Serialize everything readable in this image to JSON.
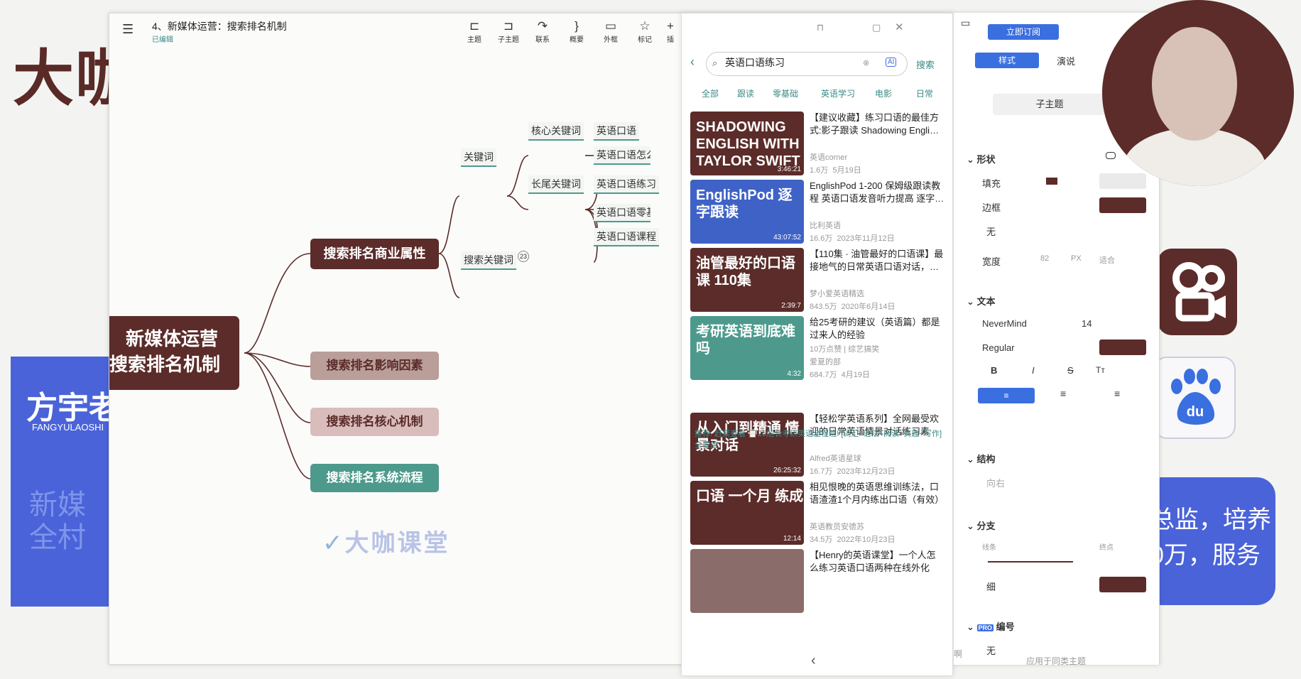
{
  "background": {
    "big_title": "大咖",
    "blue_card": {
      "name": "方宇老",
      "name_latin": "FANGYULAOSHI",
      "faded": [
        "新媒",
        "全村"
      ]
    },
    "right_card": [
      "总监，培养",
      "0万，服务"
    ]
  },
  "mindmap": {
    "title": "4、新媒体运营：搜索排名机制",
    "subtitle": "已编辑",
    "toolbar": [
      {
        "label": "主题",
        "icon": "⊏"
      },
      {
        "label": "子主题",
        "icon": "⊐"
      },
      {
        "label": "联系",
        "icon": "↷"
      },
      {
        "label": "概要",
        "icon": "}"
      },
      {
        "label": "外框",
        "icon": "▭"
      },
      {
        "label": "标记",
        "icon": "☆"
      },
      {
        "label": "插",
        "icon": "+"
      }
    ],
    "center_lines": [
      "新媒体运营",
      "搜索排名机制"
    ],
    "branches": [
      "搜索排名商业属性",
      "搜索排名影响因素",
      "搜索排名核心机制",
      "搜索排名系统流程"
    ],
    "keyword": "关键词",
    "search_keyword": "搜索关键词",
    "core_keyword": "核心关键词",
    "long_tail": "长尾关键词",
    "leaves": [
      "英语口语",
      "英语口语怎么练",
      "英语口语练习",
      "英语口语零基础",
      "英语口语课程"
    ],
    "collapse_count": "23",
    "watermark": "大咖课堂"
  },
  "video_panel": {
    "search_value": "英语口语练习",
    "search_button": "搜索",
    "categories": [
      "全部",
      "跟读",
      "零基础",
      "英语学习",
      "电影",
      "日常"
    ],
    "videos": [
      {
        "title": "【建议收藏】练习口语的最佳方式:影子跟读 Shadowing Engli…",
        "author": "英语corner",
        "views": "1.6万",
        "date": "5月19日",
        "duration": "3:46:21",
        "thumb_text": "SHADOWING ENGLISH WITH TAYLOR SWIFT",
        "thumb_color": "#5b2c29"
      },
      {
        "title": "EnglishPod 1-200 保姆级跟读教程 英语口语发音听力提高 逐字…",
        "author": "比利英语",
        "views": "16.6万",
        "date": "2023年11月12日",
        "duration": "43:07:52",
        "thumb_text": "EnglishPod 逐字跟读",
        "thumb_color": "#3f62c6"
      },
      {
        "title": "【110集 · 油管最好的口语课】最接地气的日常英语口语对话，…",
        "author": "梦小爱英语精选",
        "views": "843.5万",
        "date": "2020年6月14日",
        "duration": "2:39:7",
        "thumb_text": "油管最好的口语课 110集",
        "thumb_color": "#5b2c29"
      },
      {
        "title": "给25考研的建议（英语篇）都是过来人的经验",
        "author": "爱夏的部",
        "views": "684.7万",
        "date": "4月19日",
        "duration": "4:32",
        "thumb_text": "考研英语到底难吗",
        "thumb_color": "#4d9a8c",
        "tag": "10万点赞 | 综艺搞笑"
      },
      {
        "title": "【轻松学英语系列】全网最受欢迎的日常英语情景对话练习素材…",
        "author": "Alfred英语星球",
        "views": "16.7万",
        "date": "2023年12月23日",
        "duration": "26:25:32",
        "thumb_text": "从入门到精通 情景对话",
        "thumb_color": "#5b2c29"
      },
      {
        "title": "相见恨晚的英语思维训练法，口语渣渣1个月内练出口语（有效）",
        "author": "英语教员安德苏",
        "views": "34.5万",
        "date": "2022年10月23日",
        "duration": "12:14",
        "thumb_text": "口语 一个月 练成",
        "thumb_color": "#5b2c29"
      },
      {
        "title": "【Henry的英语课堂】一个人怎么练习英语口语两种在线外化时…",
        "author": "",
        "views": "",
        "date": "",
        "duration": "",
        "thumb_text": "",
        "thumb_color": "#8a6d6a"
      }
    ],
    "recommend": "推荐: 赶紧查看 📋25船长考研英语全程班! [词汇+语法+阅读+真题+写作]全覆盖"
  },
  "settings": {
    "subscribe": "立即订阅",
    "tabs": [
      "样式",
      "演说"
    ],
    "topic": "子主题",
    "shape": "形状",
    "fill": "填充",
    "border": "边框",
    "none": "无",
    "width": "宽度",
    "width_vals": [
      "82",
      "PX",
      "适合"
    ],
    "text": "文本",
    "font": "NeverMind",
    "size": "14",
    "weight": "Regular",
    "structure": "结构",
    "direction": "向右",
    "branch": "分支",
    "line": "线条",
    "end": "终点",
    "thin": "细",
    "numbering": "编号",
    "pro": "PRO",
    "numbering_val": "无",
    "apply_all": "应用于同类主题",
    "side_char": "啊"
  },
  "colors": {
    "brand_dark": "#5b2c29",
    "teal": "#4d9a8c",
    "blue": "#3a6fe0"
  }
}
